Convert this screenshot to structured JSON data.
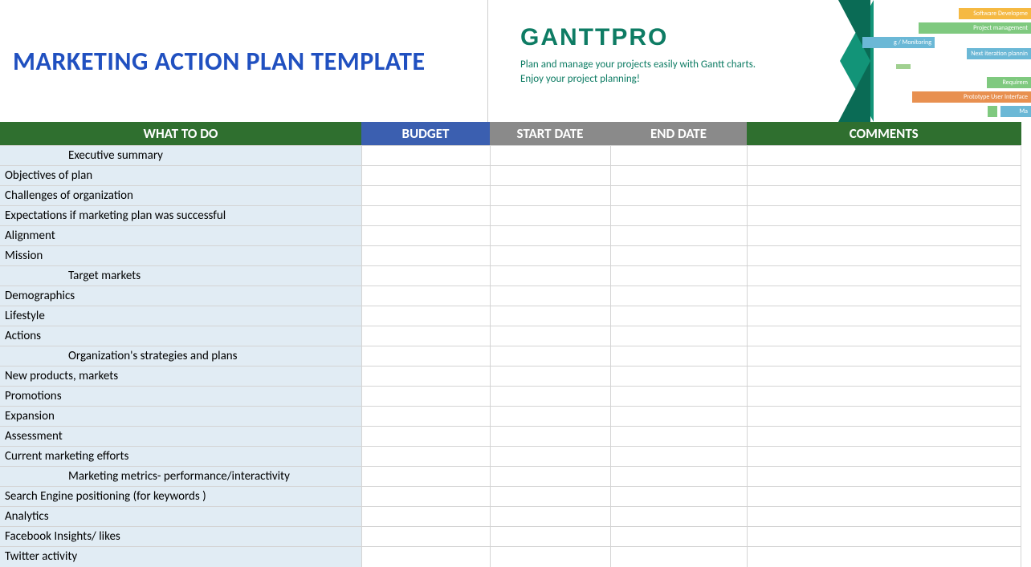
{
  "header": {
    "title": "MARKETING ACTION PLAN TEMPLATE",
    "logo": "GANTTPRO",
    "tagline1": "Plan and manage your projects easily with Gantt charts.",
    "tagline2": "Enjoy your project planning!",
    "decor_labels": {
      "b1": "Software Developme",
      "b2": "Project management",
      "b3": "g / Monitoring",
      "b4": "Next iteration plannin",
      "b5": "Requirem",
      "b6": "Prototype User Interface",
      "b7": "Ma"
    }
  },
  "columns": {
    "what": "WHAT TO DO",
    "budget": "BUDGET",
    "start": "START DATE",
    "end": "END DATE",
    "comments": "COMMENTS"
  },
  "rows": [
    {
      "type": "section",
      "label": "Executive summary"
    },
    {
      "type": "item",
      "label": "Objectives of plan"
    },
    {
      "type": "item",
      "label": "Challenges of organization"
    },
    {
      "type": "item",
      "label": "Expectations if marketing plan was successful"
    },
    {
      "type": "item",
      "label": "Alignment"
    },
    {
      "type": "item",
      "label": "Mission"
    },
    {
      "type": "section",
      "label": "Target markets"
    },
    {
      "type": "item",
      "label": "Demographics"
    },
    {
      "type": "item",
      "label": "Lifestyle"
    },
    {
      "type": "item",
      "label": "Actions"
    },
    {
      "type": "section",
      "label": "Organization's strategies and plans"
    },
    {
      "type": "item",
      "label": "New products, markets"
    },
    {
      "type": "item",
      "label": "Promotions"
    },
    {
      "type": "item",
      "label": "Expansion"
    },
    {
      "type": "item",
      "label": "Assessment"
    },
    {
      "type": "item",
      "label": "Current marketing efforts"
    },
    {
      "type": "section",
      "label": "Marketing metrics- performance/interactivity"
    },
    {
      "type": "item",
      "label": "Search Engine positioning (for keywords )"
    },
    {
      "type": "item",
      "label": "Analytics"
    },
    {
      "type": "item",
      "label": "Facebook Insights/ likes"
    },
    {
      "type": "item",
      "label": "Twitter activity"
    }
  ]
}
